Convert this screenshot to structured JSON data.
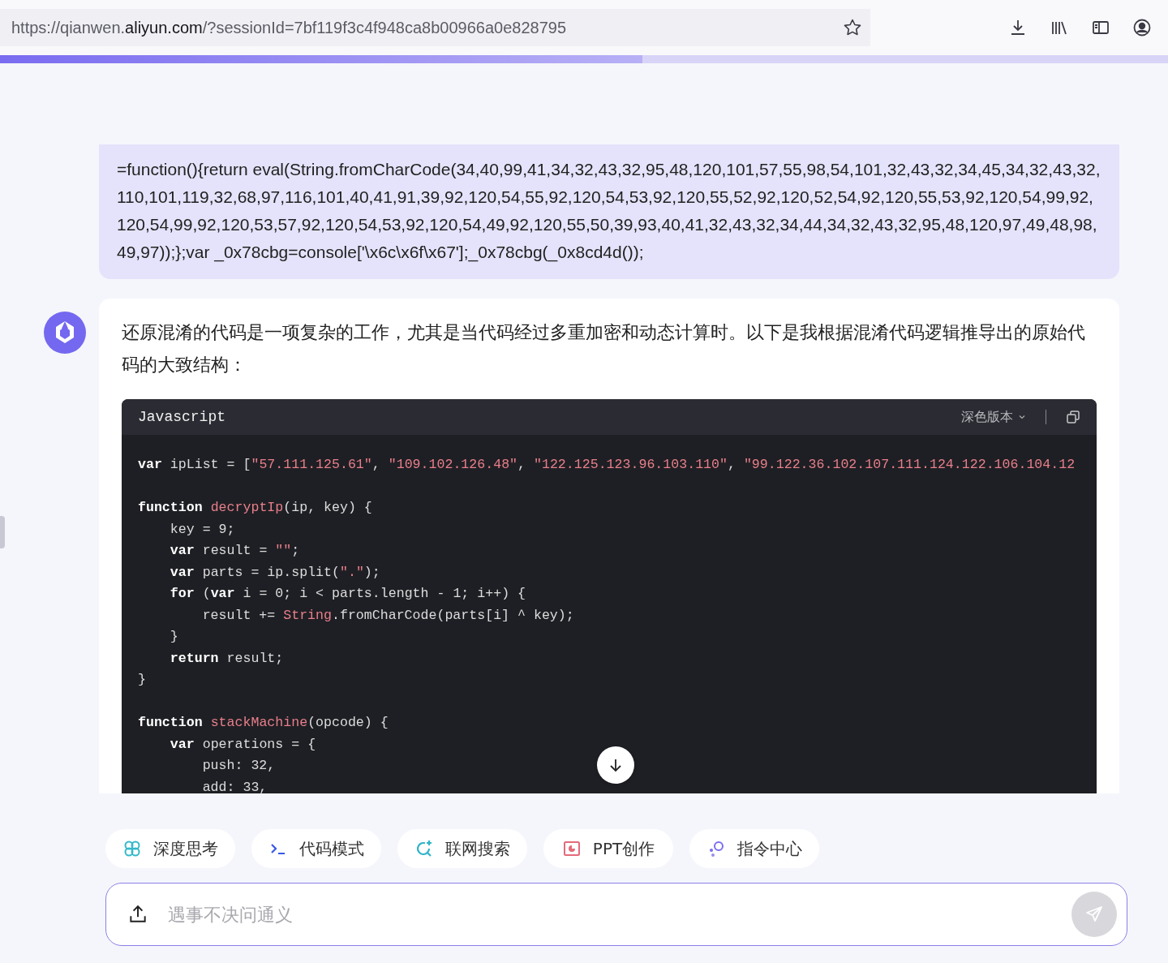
{
  "browser": {
    "url": {
      "prefix": "https://qianwen.",
      "domain": "aliyun.com",
      "suffix": "/?sessionId=7bf119f3c4f948ca8b00966a0e828795"
    },
    "bookmarked": false,
    "level": 0.55
  },
  "user_message": {
    "text": "=function(){return eval(String.fromCharCode(34,40,99,41,34,32,43,32,95,48,120,101,57,55,98,54,101,32,43,32,34,45,34,32,43,32,110,101,119,32,68,97,116,101,40,41,91,39,92,120,54,55,92,120,54,53,92,120,55,52,92,120,52,54,92,120,55,53,92,120,54,99,92,120,54,99,92,120,53,57,92,120,54,53,92,120,54,49,92,120,55,50,39,93,40,41,32,43,32,34,44,34,32,43,32,95,48,120,97,49,48,98,49,97));};var _0x78cbg=console['\\x6c\\x6f\\x67'];_0x78cbg(_0x8cd4d());"
  },
  "assistant_message": {
    "text": "还原混淆的代码是一项复杂的工作，尤其是当代码经过多重加密和动态计算时。以下是我根据混淆代码逻辑推导出的原始代码的大致结构：",
    "code": {
      "language": "Javascript",
      "theme": "深色版本",
      "blocks": [
        {
          "lines": [
            [
              {
                "kind": "kw",
                "text": "var"
              },
              {
                "kind": "plain",
                "text": " ipList = ["
              },
              {
                "kind": "str",
                "text": "\"57.111.125.61\""
              },
              {
                "kind": "plain",
                "text": ", "
              },
              {
                "kind": "str",
                "text": "\"109.102.126.48\""
              },
              {
                "kind": "plain",
                "text": ", "
              },
              {
                "kind": "str",
                "text": "\"122.125.123.96.103.110\""
              },
              {
                "kind": "plain",
                "text": ", "
              },
              {
                "kind": "str",
                "text": "\"99.122.36.102.107.111.124.122.106.104.12"
              }
            ]
          ]
        },
        {
          "lines": [
            [
              {
                "kind": "kw",
                "text": "function"
              },
              {
                "kind": "fn",
                "text": " decryptIp"
              },
              {
                "kind": "plain",
                "text": "(ip, key) {"
              }
            ],
            [
              {
                "kind": "plain",
                "text": "    key = 9;"
              }
            ],
            [
              {
                "kind": "kw",
                "text": "    var"
              },
              {
                "kind": "plain",
                "text": " result = "
              },
              {
                "kind": "str",
                "text": "\"\""
              },
              {
                "kind": "plain",
                "text": ";"
              }
            ],
            [
              {
                "kind": "kw",
                "text": "    var"
              },
              {
                "kind": "plain",
                "text": " parts = ip.split("
              },
              {
                "kind": "str",
                "text": "\".\""
              },
              {
                "kind": "plain",
                "text": ");"
              }
            ],
            [
              {
                "kind": "kw",
                "text": "    for"
              },
              {
                "kind": "plain",
                "text": " ("
              },
              {
                "kind": "kw",
                "text": "var"
              },
              {
                "kind": "plain",
                "text": " i = 0; i < parts.length - 1; i++) {"
              }
            ],
            [
              {
                "kind": "plain",
                "text": "        result += "
              },
              {
                "kind": "fn",
                "text": "String"
              },
              {
                "kind": "plain",
                "text": ".fromCharCode(parts[i] ^ key);"
              }
            ],
            [
              {
                "kind": "plain",
                "text": "    }"
              }
            ],
            [
              {
                "kind": "kw",
                "text": "    return"
              },
              {
                "kind": "plain",
                "text": " result;"
              }
            ],
            [
              {
                "kind": "plain",
                "text": "}"
              }
            ]
          ]
        },
        {
          "lines": [
            [
              {
                "kind": "kw",
                "text": "function"
              },
              {
                "kind": "fn",
                "text": " stackMachine"
              },
              {
                "kind": "plain",
                "text": "(opcode) {"
              }
            ],
            [
              {
                "kind": "kw",
                "text": "    var"
              },
              {
                "kind": "plain",
                "text": " operations = {"
              }
            ],
            [
              {
                "kind": "plain",
                "text": "        push: 32,"
              }
            ],
            [
              {
                "kind": "plain",
                "text": "        add: 33,"
              }
            ]
          ]
        }
      ]
    }
  },
  "tools": [
    {
      "label": "深度思考",
      "kind": "think"
    },
    {
      "label": "代码模式",
      "kind": "code"
    },
    {
      "label": "联网搜索",
      "kind": "search"
    },
    {
      "label": "PPT创作",
      "kind": "ppt"
    },
    {
      "label": "指令中心",
      "kind": "command"
    }
  ],
  "composer": {
    "placeholder": "遇事不决问通义"
  }
}
